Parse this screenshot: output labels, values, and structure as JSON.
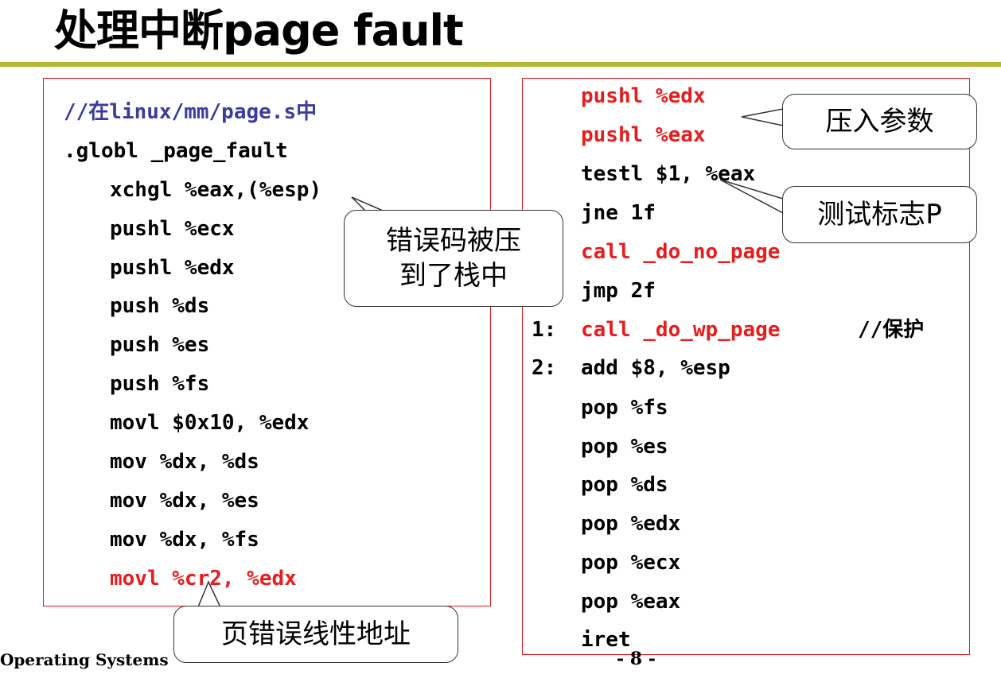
{
  "slide": {
    "title": "处理中断page fault",
    "footer_left": "Operating Systems",
    "page_number": "- 8 -"
  },
  "left_code": {
    "lines": [
      {
        "text": "//在linux/mm/page.s中",
        "color": "blue"
      },
      {
        "text": ".globl _page_fault",
        "color": "black"
      },
      {
        "text": "xchgl %eax,(%esp)",
        "color": "black"
      },
      {
        "text": "pushl %ecx",
        "color": "black"
      },
      {
        "text": "pushl %edx",
        "color": "black"
      },
      {
        "text": "push %ds",
        "color": "black"
      },
      {
        "text": "push %es",
        "color": "black"
      },
      {
        "text": "push %fs",
        "color": "black"
      },
      {
        "text": "movl $0x10, %edx",
        "color": "black"
      },
      {
        "text": "mov %dx, %ds",
        "color": "black"
      },
      {
        "text": "mov %dx, %es",
        "color": "black"
      },
      {
        "text": "mov %dx, %fs",
        "color": "black"
      },
      {
        "text": "movl %cr2, %edx",
        "color": "red"
      }
    ]
  },
  "right_code": {
    "lines": [
      {
        "text": "pushl %edx",
        "color": "red"
      },
      {
        "text": "pushl %eax",
        "color": "red"
      },
      {
        "text": "testl $1, %eax",
        "color": "black"
      },
      {
        "text": "jne 1f",
        "color": "black"
      },
      {
        "text": "call _do_no_page",
        "color": "red"
      },
      {
        "text": "jmp 2f",
        "color": "black"
      },
      {
        "label": "1:",
        "text": "call _do_wp_page",
        "comment": "//保护",
        "color": "red"
      },
      {
        "label": "2:",
        "text": "add $8, %esp",
        "color": "black"
      },
      {
        "text": "pop %fs",
        "color": "black"
      },
      {
        "text": "pop %es",
        "color": "black"
      },
      {
        "text": "pop %ds",
        "color": "black"
      },
      {
        "text": "pop %edx",
        "color": "black"
      },
      {
        "text": "pop %ecx",
        "color": "black"
      },
      {
        "text": "pop %eax",
        "color": "black"
      },
      {
        "text": "iret",
        "color": "black"
      }
    ]
  },
  "callouts": {
    "error_code": "错误码被压\n到了栈中",
    "push_args": "压入参数",
    "test_flag": "测试标志P",
    "fault_addr": "页错误线性地址"
  },
  "colors": {
    "title_rule": "#b5b834",
    "panel_border": "#e0141c",
    "code_red": "#e81c1c",
    "code_blue": "#3b3ba0"
  }
}
